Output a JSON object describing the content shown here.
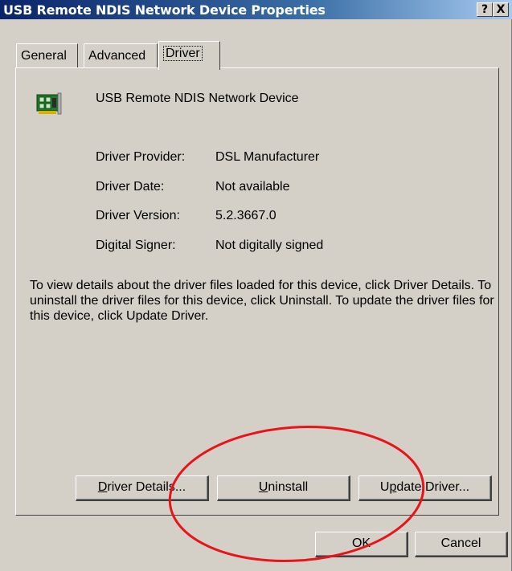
{
  "window": {
    "title": "USB Remote NDIS Network Device Properties",
    "help_btn": "?",
    "close_btn": "X"
  },
  "tabs": [
    {
      "label": "General"
    },
    {
      "label": "Advanced"
    },
    {
      "label": "Driver"
    }
  ],
  "device": {
    "name": "USB Remote NDIS Network Device",
    "icon": "network-card-icon"
  },
  "properties": [
    {
      "label": "Driver Provider:",
      "value": "DSL Manufacturer"
    },
    {
      "label": "Driver Date:",
      "value": "Not available"
    },
    {
      "label": "Driver Version:",
      "value": "5.2.3667.0"
    },
    {
      "label": "Digital Signer:",
      "value": "Not digitally signed"
    }
  ],
  "info_text": "To view details about the driver files loaded for this device, click Driver Details. To uninstall the driver files for this device, click Uninstall. To update the driver files for this device, click Update Driver.",
  "buttons": {
    "driver_details": {
      "accel": "D",
      "rest": "river Details..."
    },
    "uninstall": {
      "accel": "U",
      "rest": "ninstall"
    },
    "update_driver": {
      "pre": "U",
      "accel": "p",
      "rest": "date Driver..."
    },
    "ok": "OK",
    "cancel": "Cancel"
  },
  "annotation": {
    "color": "#e8141a"
  }
}
